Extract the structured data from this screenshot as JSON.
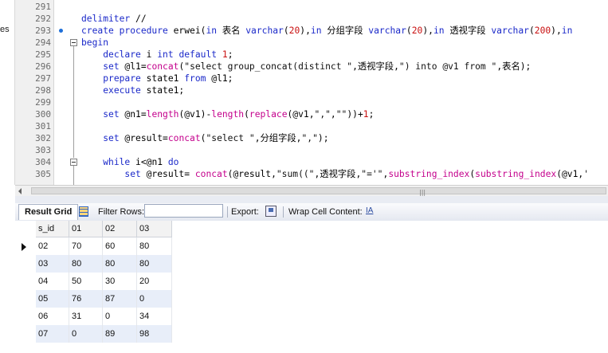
{
  "object_browser": {
    "visible_fragment": "es"
  },
  "editor": {
    "lines": [
      {
        "n": "291",
        "html": ""
      },
      {
        "n": "292",
        "html": "<span class='kw'>delimiter</span> //"
      },
      {
        "n": "293",
        "html": "<span class='kw'>create procedure</span> erwei(<span class='kw'>in</span> 表名 <span class='kw'>varchar</span>(<span class='num'>20</span>),<span class='kw'>in</span> 分组字段 <span class='kw'>varchar</span>(<span class='num'>20</span>),<span class='kw'>in</span> 透视字段 <span class='kw'>varchar</span>(<span class='num'>200</span>),<span class='kw'>in</span>"
      },
      {
        "n": "294",
        "html": "<span class='kw'>begin</span>"
      },
      {
        "n": "295",
        "html": "    <span class='kw'>declare</span> i <span class='kw'>int default</span> <span class='num'>1</span>;"
      },
      {
        "n": "296",
        "html": "    <span class='kw'>set</span> @l1=<span class='fn'>concat</span>(<span class='str'>\"select group_concat(distinct \"</span>,透视字段,<span class='str'>\") into @v1 from \"</span>,表名);"
      },
      {
        "n": "297",
        "html": "    <span class='kw'>prepare</span> state1 <span class='kw'>from</span> @l1;"
      },
      {
        "n": "298",
        "html": "    <span class='kw'>execute</span> state1;"
      },
      {
        "n": "299",
        "html": ""
      },
      {
        "n": "300",
        "html": "    <span class='kw'>set</span> @n1=<span class='fn'>length</span>(@v1)-<span class='fn'>length</span>(<span class='fn'>replace</span>(@v1,<span class='str'>\",\"</span>,<span class='str'>\"\"</span>))+<span class='num'>1</span>;"
      },
      {
        "n": "301",
        "html": ""
      },
      {
        "n": "302",
        "html": "    <span class='kw'>set</span> @result=<span class='fn'>concat</span>(<span class='str'>\"select \"</span>,分组字段,<span class='str'>\",\"</span>);"
      },
      {
        "n": "303",
        "html": ""
      },
      {
        "n": "304",
        "html": "    <span class='kw'>while</span> i&lt;@n1 <span class='kw'>do</span>"
      },
      {
        "n": "305",
        "html": "        <span class='kw'>set</span> @result= <span class='fn'>concat</span>(@result,<span class='str'>\"sum((\"</span>,透视字段,<span class='str'>\"='\"</span>,<span class='fn'>substring_index</span>(<span class='fn'>substring_index</span>(@v1,<span class='str'>'</span>"
      }
    ]
  },
  "results_toolbar": {
    "result_grid_tab": "Result Grid",
    "filter_rows_label": "Filter Rows:",
    "filter_rows_value": "",
    "export_label": "Export:",
    "wrap_cell_label": "Wrap Cell Content:",
    "wrap_icon": "IA"
  },
  "result_grid": {
    "columns": [
      "s_id",
      "01",
      "02",
      "03"
    ],
    "rows": [
      [
        "02",
        "70",
        "60",
        "80"
      ],
      [
        "03",
        "80",
        "80",
        "80"
      ],
      [
        "04",
        "50",
        "30",
        "20"
      ],
      [
        "05",
        "76",
        "87",
        "0"
      ],
      [
        "06",
        "31",
        "0",
        "34"
      ],
      [
        "07",
        "0",
        "89",
        "98"
      ]
    ]
  },
  "icons": [
    "breakpoint-dot-icon",
    "fold-toggle-icon",
    "scroll-left-arrow-icon",
    "grid-icon",
    "export-icon",
    "wrap-cell-icon",
    "current-row-arrow-icon"
  ],
  "colors": {
    "keyword": "#1a28c9",
    "function": "#c4008c",
    "number": "#c91010",
    "row_alt": "#e8eef9"
  }
}
